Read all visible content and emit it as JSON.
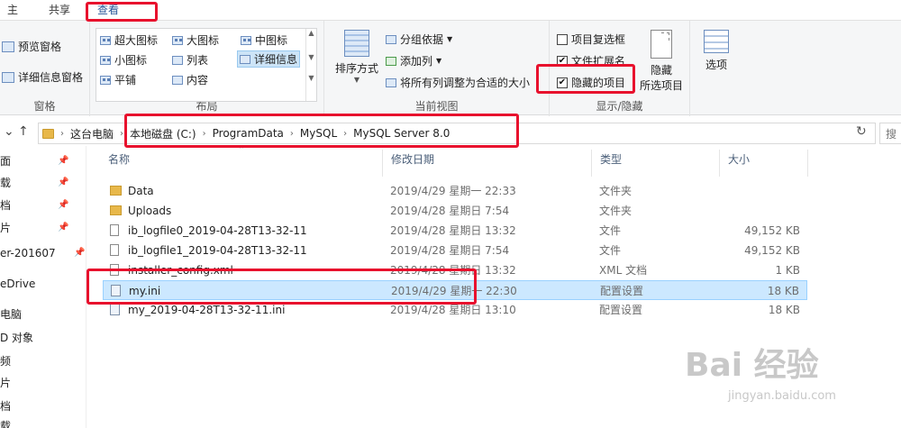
{
  "tabs": [
    "主页",
    "共享",
    "查看"
  ],
  "ribbon": {
    "panes": {
      "preview": "预览窗格",
      "details": "详细信息窗格",
      "label": "窗格"
    },
    "layout": {
      "items": [
        "超大图标",
        "大图标",
        "中图标",
        "小图标",
        "列表",
        "详细信息",
        "平铺",
        "内容"
      ],
      "selected": "详细信息",
      "label": "布局"
    },
    "current_view": {
      "sort": "排序方式",
      "group_by": "分组依据",
      "add_column": "添加列",
      "fit_columns": "将所有列调整为合适的大小",
      "label": "当前视图"
    },
    "show_hide": {
      "item_checkboxes": "项目复选框",
      "file_extensions": "文件扩展名",
      "hidden_items": "隐藏的项目",
      "hide_selected_line1": "隐藏",
      "hide_selected_line2": "所选项目",
      "label": "显示/隐藏",
      "item_checkboxes_checked": false,
      "file_extensions_checked": true,
      "hidden_items_checked": true
    },
    "options": "选项"
  },
  "address": {
    "crumbs": [
      "这台电脑",
      "本地磁盘 (C:)",
      "ProgramData",
      "MySQL",
      "MySQL Server 8.0"
    ],
    "search_placeholder": "搜"
  },
  "nav": [
    "面",
    "载",
    "档",
    "片",
    "er-201607",
    "eDrive",
    "电脑",
    "D 对象",
    "频",
    "片",
    "档",
    "载"
  ],
  "columns": [
    "名称",
    "修改日期",
    "类型",
    "大小"
  ],
  "files": [
    {
      "name": "Data",
      "date": "2019/4/29 星期一 22:33",
      "type": "文件夹",
      "size": "",
      "kind": "folder"
    },
    {
      "name": "Uploads",
      "date": "2019/4/28 星期日 7:54",
      "type": "文件夹",
      "size": "",
      "kind": "folder"
    },
    {
      "name": "ib_logfile0_2019-04-28T13-32-11",
      "date": "2019/4/28 星期日 13:32",
      "type": "文件",
      "size": "49,152 KB",
      "kind": "file"
    },
    {
      "name": "ib_logfile1_2019-04-28T13-32-11",
      "date": "2019/4/28 星期日 7:54",
      "type": "文件",
      "size": "49,152 KB",
      "kind": "file"
    },
    {
      "name": "installer_config.xml",
      "date": "2019/4/28 星期日 13:32",
      "type": "XML 文档",
      "size": "1 KB",
      "kind": "file"
    },
    {
      "name": "my.ini",
      "date": "2019/4/29 星期一 22:30",
      "type": "配置设置",
      "size": "18 KB",
      "kind": "config",
      "selected": true
    },
    {
      "name": "my_2019-04-28T13-32-11.ini",
      "date": "2019/4/28 星期日 13:10",
      "type": "配置设置",
      "size": "18 KB",
      "kind": "config"
    }
  ],
  "watermark": {
    "main": "Bai 经验",
    "sub": "jingyan.baidu.com"
  },
  "colors": {
    "annotation": "#e8112d",
    "selection": "#cce8ff",
    "folder": "#e8b84a"
  }
}
